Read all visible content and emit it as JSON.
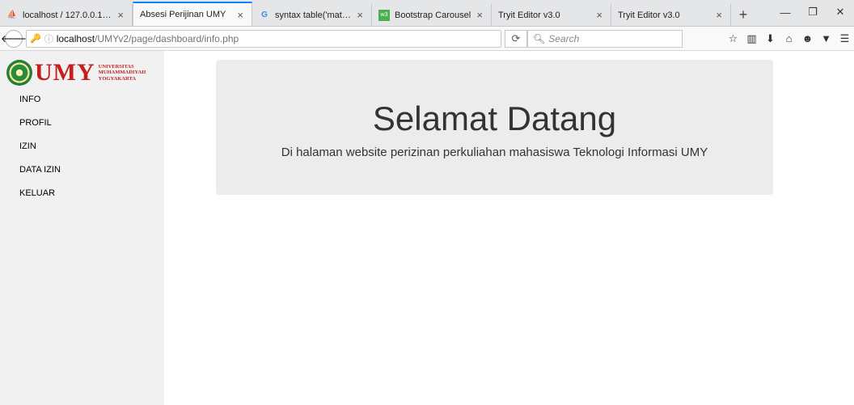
{
  "browser": {
    "tabs": [
      {
        "title": "localhost / 127.0.0.1 / ...",
        "icon": "phpmyadmin-icon",
        "active": false
      },
      {
        "title": "Absesi Perijinan UMY",
        "icon": "",
        "active": true
      },
      {
        "title": "syntax table('matakuli...",
        "icon": "google-icon",
        "active": false
      },
      {
        "title": "Bootstrap Carousel",
        "icon": "w3schools-icon",
        "active": false
      },
      {
        "title": "Tryit Editor v3.0",
        "icon": "",
        "active": false
      },
      {
        "title": "Tryit Editor v3.0",
        "icon": "",
        "active": false
      }
    ],
    "url_host": "localhost",
    "url_path": "/UMYv2/page/dashboard/info.php",
    "search_placeholder": "Search"
  },
  "logo": {
    "text": "UMY",
    "sub_line1": "UNIVERSITAS",
    "sub_line2": "MUHAMMADIYAH",
    "sub_line3": "YOGYAKARTA",
    "brand_color": "#c41e1e"
  },
  "sidebar": {
    "items": [
      {
        "label": "INFO"
      },
      {
        "label": "PROFIL"
      },
      {
        "label": "IZIN"
      },
      {
        "label": "DATA IZIN"
      },
      {
        "label": "KELUAR"
      }
    ]
  },
  "main": {
    "heading": "Selamat Datang",
    "subtext": "Di halaman website perizinan perkuliahan mahasiswa Teknologi Informasi UMY"
  }
}
